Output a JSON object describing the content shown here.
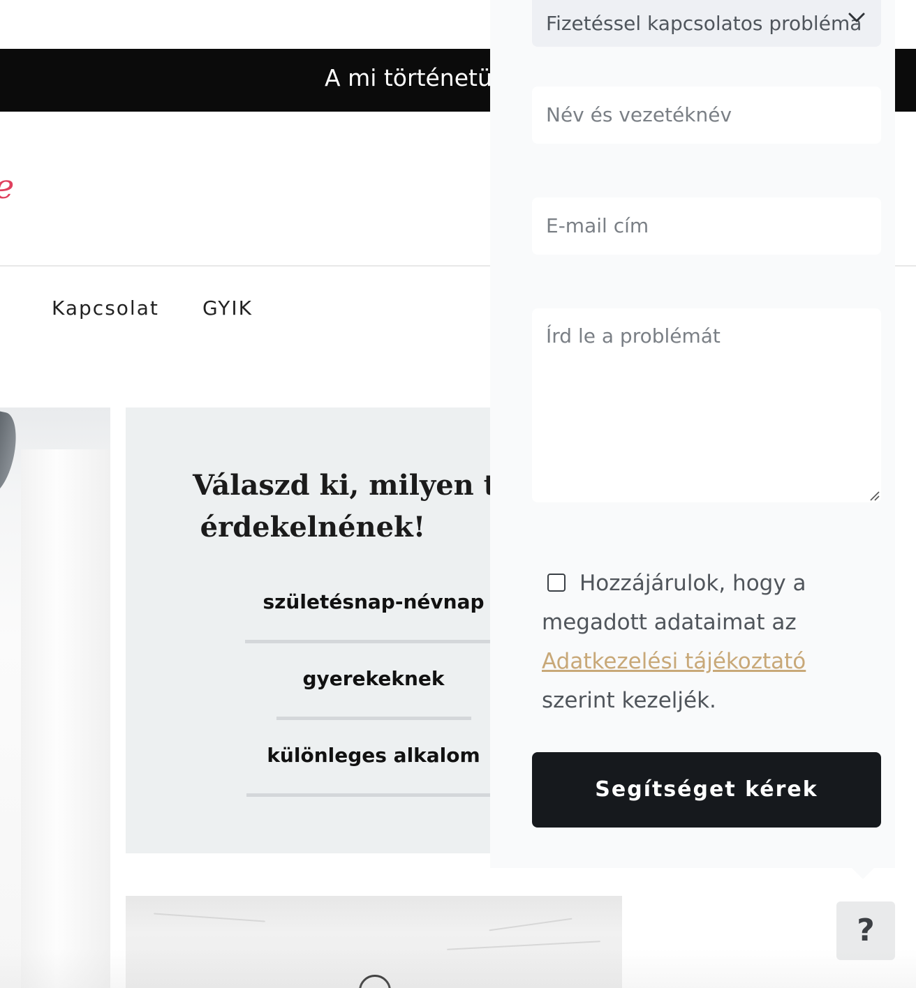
{
  "topbar": {
    "link": "A mi történetünk"
  },
  "logo": {
    "fragment": "e"
  },
  "nav": {
    "items": [
      "Kapcsolat",
      "GYIK"
    ]
  },
  "card": {
    "title_line1": "Válaszd ki, milyen term",
    "title_line2": "érdekelnének!",
    "categories": [
      "születésnap-névnap",
      "gyerekeknek",
      "különleges alkalom"
    ]
  },
  "help_form": {
    "topic_selected": "Fizetéssel kapcsolatos probléma",
    "name_placeholder": "Név és vezetéknév",
    "email_placeholder": "E-mail cím",
    "description_placeholder": "Írd le a problémát",
    "consent_prefix": "Hozzájárulok, hogy a megadott adataimat az",
    "consent_link": "Adatkezelési tájékoztató",
    "consent_suffix": "szerint kezeljék.",
    "submit_label": "Segítséget kérek"
  },
  "help_button": {
    "label": "?"
  },
  "colors": {
    "accent_link": "#c8a878",
    "logo_pink": "#e0405e",
    "button_dark": "#16191d",
    "topbar_bg": "#0b0b0b"
  },
  "icons": [
    "chevron-down-icon",
    "resize-handle-icon",
    "checkbox-icon",
    "question-icon"
  ]
}
